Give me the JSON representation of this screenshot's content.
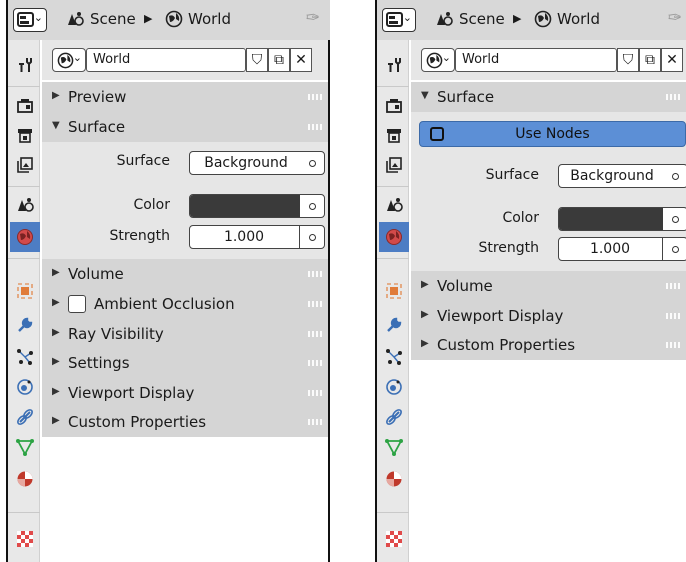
{
  "header": {
    "scene": "Scene",
    "world": "World"
  },
  "datablock": {
    "name": "World"
  },
  "left_panel": {
    "sections": {
      "preview": "Preview",
      "surface": "Surface",
      "volume": "Volume",
      "ambient_occlusion": "Ambient Occlusion",
      "ray_visibility": "Ray Visibility",
      "settings": "Settings",
      "viewport_display": "Viewport Display",
      "custom_properties": "Custom Properties"
    },
    "surface": {
      "surface_label": "Surface",
      "surface_value": "Background",
      "color_label": "Color",
      "color_value": "#3a3a3a",
      "strength_label": "Strength",
      "strength_value": "1.000"
    }
  },
  "right_panel": {
    "sections": {
      "surface": "Surface",
      "volume": "Volume",
      "viewport_display": "Viewport Display",
      "custom_properties": "Custom Properties"
    },
    "use_nodes": "Use Nodes",
    "surface": {
      "surface_label": "Surface",
      "surface_value": "Background",
      "color_label": "Color",
      "color_value": "#3a3a3a",
      "strength_label": "Strength",
      "strength_value": "1.000"
    }
  },
  "tabs": [
    "tool",
    "render",
    "output",
    "view-layer",
    "scene",
    "world",
    "object",
    "modifiers",
    "particles",
    "physics",
    "constraints",
    "object-data",
    "material",
    "texture"
  ],
  "active_tab": "world",
  "colors": {
    "accent": "#4d7dc4",
    "use_nodes": "#5c8fd6",
    "section": "#d5d5d5"
  }
}
